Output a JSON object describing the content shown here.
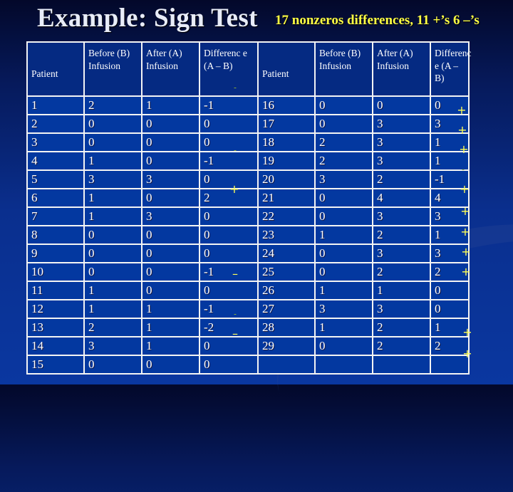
{
  "slide": {
    "title": "Example: Sign Test",
    "subtitle": "17 nonzeros differences, 11 +’s  6 –’s"
  },
  "table_headers": [
    "Patient",
    "Before (B) Infusion",
    "After (A) Infusion",
    "Differenc e (A – B)"
  ],
  "left_table": {
    "headers": [
      "Patient",
      "Before (B) Infusion",
      "After (A) Infusion",
      "Differenc e (A – B)"
    ],
    "rows": [
      [
        "1",
        "2",
        "1",
        "-1"
      ],
      [
        "2",
        "0",
        "0",
        "0"
      ],
      [
        "3",
        "0",
        "0",
        "0"
      ],
      [
        "4",
        "1",
        "0",
        "-1"
      ],
      [
        "5",
        "3",
        "3",
        "0"
      ],
      [
        "6",
        "1",
        "0",
        "2"
      ],
      [
        "7",
        "1",
        "3",
        "0"
      ],
      [
        "8",
        "0",
        "0",
        "0"
      ],
      [
        "9",
        "0",
        "0",
        "0"
      ],
      [
        "10",
        "0",
        "0",
        "-1"
      ],
      [
        "11",
        "1",
        "0",
        "0"
      ],
      [
        "12",
        "1",
        "1",
        "-1"
      ],
      [
        "13",
        "2",
        "1",
        "-2"
      ],
      [
        "14",
        "3",
        "1",
        "0"
      ],
      [
        "15",
        "0",
        "0",
        "0"
      ]
    ]
  },
  "right_table": {
    "headers": [
      "Patient",
      "Before (B) Infusion",
      "After (A) Infusion",
      "Differenc e (A – B)"
    ],
    "rows": [
      [
        "16",
        "0",
        "0",
        "0"
      ],
      [
        "17",
        "0",
        "3",
        "3"
      ],
      [
        "18",
        "2",
        "3",
        "1"
      ],
      [
        "19",
        "2",
        "3",
        "1"
      ],
      [
        "20",
        "3",
        "2",
        "-1"
      ],
      [
        "21",
        "0",
        "4",
        "4"
      ],
      [
        "22",
        "0",
        "3",
        "3"
      ],
      [
        "23",
        "1",
        "2",
        "1"
      ],
      [
        "24",
        "0",
        "3",
        "3"
      ],
      [
        "25",
        "0",
        "2",
        "2"
      ],
      [
        "26",
        "1",
        "1",
        "0"
      ],
      [
        "27",
        "3",
        "3",
        "0"
      ],
      [
        "28",
        "1",
        "2",
        "1"
      ],
      [
        "29",
        "0",
        "2",
        "2"
      ],
      [
        "",
        "",
        "",
        ""
      ]
    ]
  },
  "sign_marks": {
    "left": [
      {
        "symbol": "-",
        "dim": true
      },
      {
        "symbol": "-",
        "dim": true
      },
      {
        "symbol": "+",
        "dim": false
      },
      {
        "symbol": "–",
        "dim": false
      },
      {
        "symbol": "-",
        "dim": true
      },
      {
        "symbol": "–",
        "dim": false
      }
    ],
    "right": [
      {
        "symbol": "+",
        "dim": false
      },
      {
        "symbol": "+",
        "dim": false
      },
      {
        "symbol": "+",
        "dim": false
      },
      {
        "symbol": "-",
        "dim": true
      },
      {
        "symbol": "+",
        "dim": false
      },
      {
        "symbol": "+",
        "dim": false
      },
      {
        "symbol": "+",
        "dim": false
      },
      {
        "symbol": "+",
        "dim": false
      },
      {
        "symbol": "+",
        "dim": false
      },
      {
        "symbol": "+",
        "dim": false
      },
      {
        "symbol": "+",
        "dim": false
      }
    ]
  },
  "colors": {
    "title": "#e8ecf8",
    "subtitle": "#ffff44",
    "cell_bg": "#0338a0",
    "grid_line": "#f4f4f4",
    "sign_mark": "#ffff55"
  }
}
